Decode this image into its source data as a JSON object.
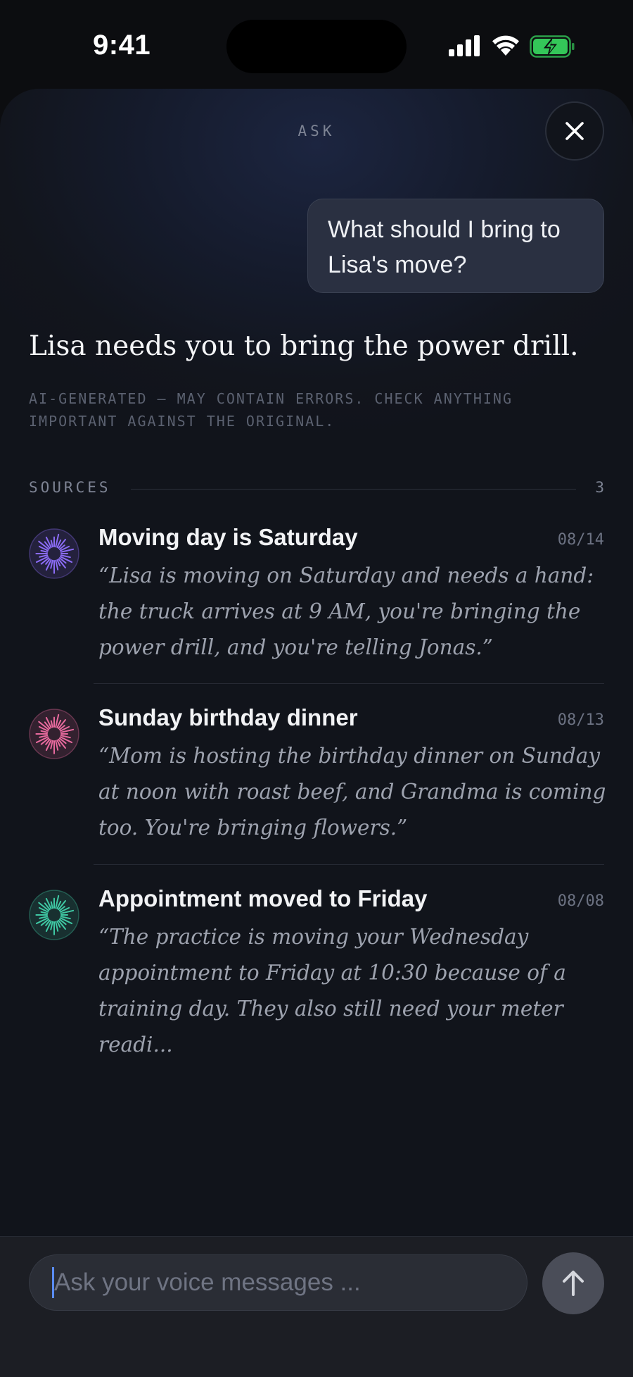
{
  "status_bar": {
    "time": "9:41",
    "battery_color": "#34c759"
  },
  "sheet": {
    "title": "ASK",
    "close_icon": "close-icon"
  },
  "conversation": {
    "user_question": "What should I bring to Lisa's move?",
    "answer": "Lisa needs you to bring the power drill.",
    "disclaimer": "AI-GENERATED — MAY CONTAIN ERRORS. CHECK ANYTHING IMPORTANT AGAINST THE ORIGINAL."
  },
  "sources": {
    "label": "SOURCES",
    "count": "3",
    "items": [
      {
        "title": "Moving day is Saturday",
        "date": "08/14",
        "quote": "“Lisa is moving on Saturday and needs a hand: the truck arrives at 9 AM, you're bringing the power drill, and you're telling Jonas.”",
        "accent": "#8b6cf5"
      },
      {
        "title": "Sunday birthday dinner",
        "date": "08/13",
        "quote": "“Mom is hosting the birthday dinner on Sunday at noon with roast beef, and Grandma is coming too. You're bringing flowers.”",
        "accent": "#e86a9e"
      },
      {
        "title": "Appointment moved to Friday",
        "date": "08/08",
        "quote": "“The practice is moving your Wednesday appointment to Friday at 10:30 because of a training day. They also still need your meter readi...",
        "accent": "#3fc9a4"
      }
    ]
  },
  "composer": {
    "placeholder": "Ask your voice messages ...",
    "send_icon": "arrow-up-icon"
  }
}
